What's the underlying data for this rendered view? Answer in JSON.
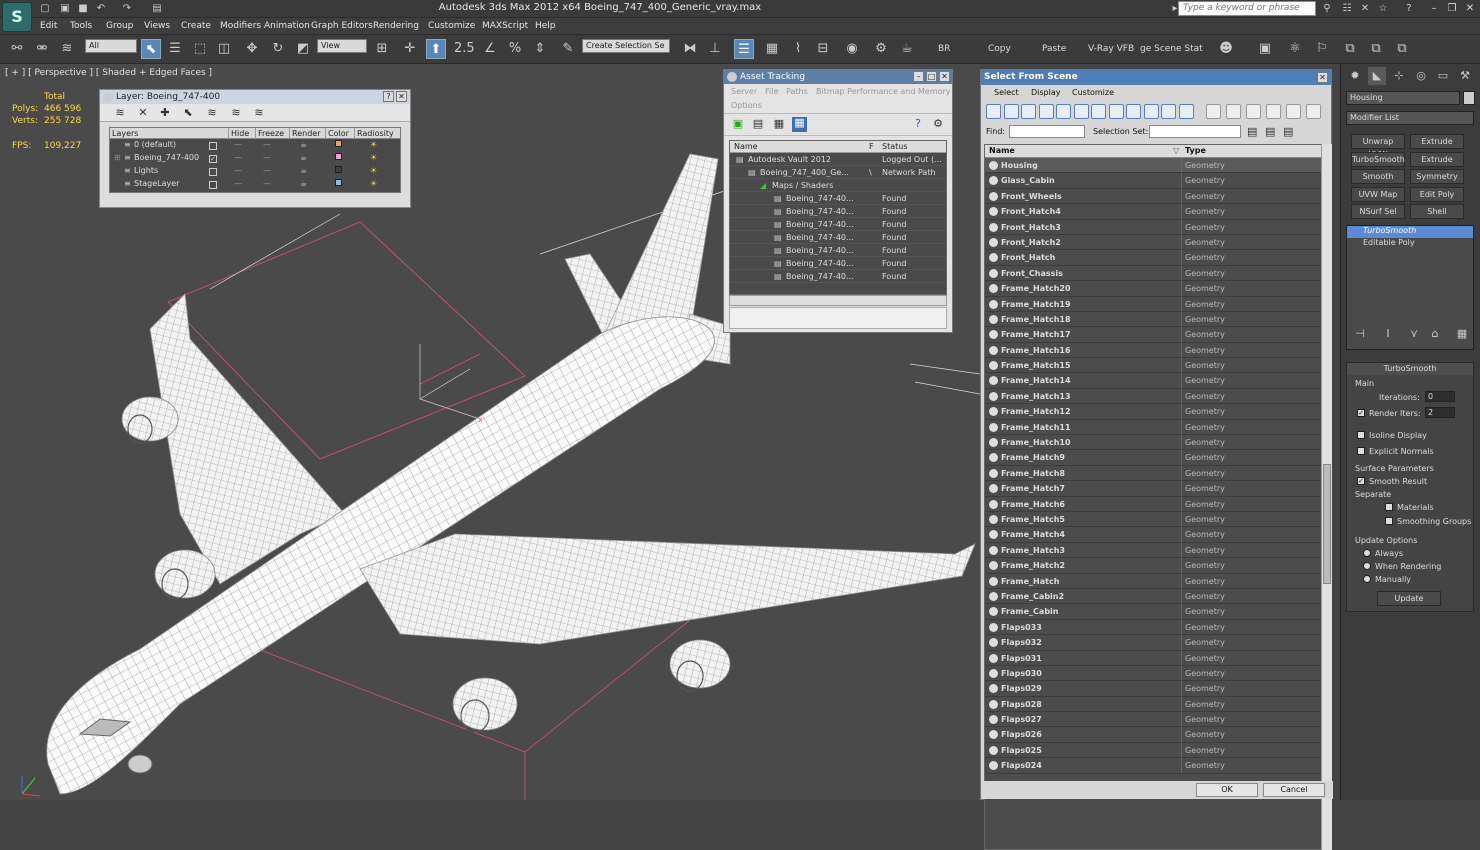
{
  "app": {
    "logo": "S",
    "title": "Autodesk 3ds Max  2012 x64      Boeing_747_400_Generic_vray.max",
    "search_placeholder": "Type a keyword or phrase"
  },
  "menu": [
    "Edit",
    "Tools",
    "Group",
    "Views",
    "Create",
    "Modifiers",
    "Animation",
    "Graph Editors",
    "Rendering",
    "Customize",
    "MAXScript",
    "Help"
  ],
  "toolbar": {
    "filter": "All",
    "ref_coord": "View",
    "snap_angle": "2.5",
    "selection_set": "Create Selection Se",
    "labels": [
      "BR",
      "Copy",
      "Paste",
      "V-Ray VFB",
      "ge Scene Stat"
    ]
  },
  "viewport": {
    "label": "[ + ] [ Perspective ] [ Shaded + Edged Faces ]",
    "stats": {
      "total_label": "Total",
      "polys_label": "Polys:",
      "polys": "466 596",
      "verts_label": "Verts:",
      "verts": "255 728",
      "fps_label": "FPS:",
      "fps": "109,227"
    }
  },
  "layer_panel": {
    "title": "Layer: Boeing_747-400",
    "columns": [
      "Layers",
      "Hide",
      "Freeze",
      "Render",
      "Color",
      "Radiosity"
    ],
    "rows": [
      {
        "name": "0 (default)",
        "color": "#e8a060"
      },
      {
        "name": "Boeing_747-400",
        "color": "#e8a0e0"
      },
      {
        "name": "Lights",
        "color": "#404040"
      },
      {
        "name": "StageLayer",
        "color": "#80c0e0"
      }
    ]
  },
  "asset_panel": {
    "title": "Asset Tracking",
    "menu": [
      "Server",
      "File",
      "Paths",
      "Bitmap Performance and Memory",
      "Options"
    ],
    "columns": [
      "Name",
      "F",
      "Status"
    ],
    "rows": [
      {
        "name": "Autodesk Vault 2012",
        "f": "",
        "status": "Logged Out (..."
      },
      {
        "name": "Boeing_747_400_Ge...",
        "f": "\\",
        "status": "Network Path"
      },
      {
        "name": "Maps / Shaders",
        "f": "",
        "status": ""
      },
      {
        "name": "Boeing_747-40...",
        "f": "",
        "status": "Found"
      },
      {
        "name": "Boeing_747-40...",
        "f": "",
        "status": "Found"
      },
      {
        "name": "Boeing_747-40...",
        "f": "",
        "status": "Found"
      },
      {
        "name": "Boeing_747-40...",
        "f": "",
        "status": "Found"
      },
      {
        "name": "Boeing_747-40...",
        "f": "",
        "status": "Found"
      },
      {
        "name": "Boeing_747-40...",
        "f": "",
        "status": "Found"
      },
      {
        "name": "Boeing_747-40...",
        "f": "",
        "status": "Found"
      }
    ]
  },
  "select_panel": {
    "title": "Select From Scene",
    "menu": [
      "Select",
      "Display",
      "Customize"
    ],
    "find_label": "Find:",
    "selection_set_label": "Selection Set:",
    "columns": [
      "Name",
      "Type"
    ],
    "rows": [
      {
        "name": "Housing",
        "type": "Geometry"
      },
      {
        "name": "Glass_Cabin",
        "type": "Geometry"
      },
      {
        "name": "Front_Wheels",
        "type": "Geometry"
      },
      {
        "name": "Front_Hatch4",
        "type": "Geometry"
      },
      {
        "name": "Front_Hatch3",
        "type": "Geometry"
      },
      {
        "name": "Front_Hatch2",
        "type": "Geometry"
      },
      {
        "name": "Front_Hatch",
        "type": "Geometry"
      },
      {
        "name": "Front_Chassis",
        "type": "Geometry"
      },
      {
        "name": "Frame_Hatch20",
        "type": "Geometry"
      },
      {
        "name": "Frame_Hatch19",
        "type": "Geometry"
      },
      {
        "name": "Frame_Hatch18",
        "type": "Geometry"
      },
      {
        "name": "Frame_Hatch17",
        "type": "Geometry"
      },
      {
        "name": "Frame_Hatch16",
        "type": "Geometry"
      },
      {
        "name": "Frame_Hatch15",
        "type": "Geometry"
      },
      {
        "name": "Frame_Hatch14",
        "type": "Geometry"
      },
      {
        "name": "Frame_Hatch13",
        "type": "Geometry"
      },
      {
        "name": "Frame_Hatch12",
        "type": "Geometry"
      },
      {
        "name": "Frame_Hatch11",
        "type": "Geometry"
      },
      {
        "name": "Frame_Hatch10",
        "type": "Geometry"
      },
      {
        "name": "Frame_Hatch9",
        "type": "Geometry"
      },
      {
        "name": "Frame_Hatch8",
        "type": "Geometry"
      },
      {
        "name": "Frame_Hatch7",
        "type": "Geometry"
      },
      {
        "name": "Frame_Hatch6",
        "type": "Geometry"
      },
      {
        "name": "Frame_Hatch5",
        "type": "Geometry"
      },
      {
        "name": "Frame_Hatch4",
        "type": "Geometry"
      },
      {
        "name": "Frame_Hatch3",
        "type": "Geometry"
      },
      {
        "name": "Frame_Hatch2",
        "type": "Geometry"
      },
      {
        "name": "Frame_Hatch",
        "type": "Geometry"
      },
      {
        "name": "Frame_Cabin2",
        "type": "Geometry"
      },
      {
        "name": "Frame_Cabin",
        "type": "Geometry"
      },
      {
        "name": "Flaps033",
        "type": "Geometry"
      },
      {
        "name": "Flaps032",
        "type": "Geometry"
      },
      {
        "name": "Flaps031",
        "type": "Geometry"
      },
      {
        "name": "Flaps030",
        "type": "Geometry"
      },
      {
        "name": "Flaps029",
        "type": "Geometry"
      },
      {
        "name": "Flaps028",
        "type": "Geometry"
      },
      {
        "name": "Flaps027",
        "type": "Geometry"
      },
      {
        "name": "Flaps026",
        "type": "Geometry"
      },
      {
        "name": "Flaps025",
        "type": "Geometry"
      },
      {
        "name": "Flaps024",
        "type": "Geometry"
      }
    ],
    "ok": "OK",
    "cancel": "Cancel"
  },
  "command_panel": {
    "object_name": "Housing",
    "modifier_list": "Modifier List",
    "buttons": [
      "Unwrap UVW",
      "Extrude",
      "TurboSmooth",
      "Extrude",
      "Smooth",
      "Symmetry",
      "UVW Map",
      "Edit Poly",
      "NSurf Sel",
      "Shell"
    ],
    "stack": [
      "TurboSmooth",
      "Editable Poly"
    ],
    "rollout": {
      "title": "TurboSmooth",
      "main": "Main",
      "iterations_label": "Iterations:",
      "iterations": "0",
      "render_iters_label": "Render Iters:",
      "render_iters": "2",
      "isoline": "Isoline Display",
      "explicit": "Explicit Normals",
      "surface": "Surface Parameters",
      "smooth_result": "Smooth Result",
      "separate": "Separate",
      "materials": "Materials",
      "smoothing_groups": "Smoothing Groups",
      "update_options": "Update Options",
      "always": "Always",
      "when_rendering": "When Rendering",
      "manually": "Manually",
      "update": "Update"
    }
  }
}
